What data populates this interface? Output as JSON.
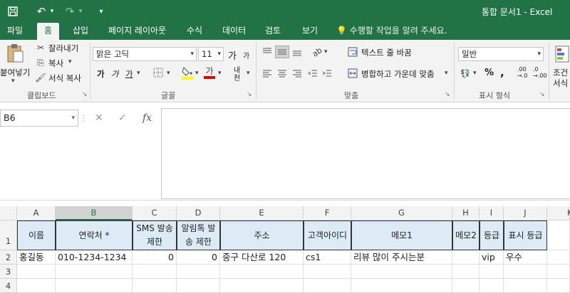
{
  "titlebar": {
    "title": "통합 문서1 - Excel",
    "quick_access": [
      "save-icon",
      "undo-icon",
      "redo-icon",
      "customize-icon"
    ]
  },
  "tabs": [
    "파일",
    "홈",
    "삽입",
    "페이지 레이아웃",
    "수식",
    "데이터",
    "검토",
    "보기"
  ],
  "active_tab": "홈",
  "tell_me": "수행할 작업을 알려 주세요.",
  "ribbon": {
    "clipboard": {
      "paste": "붙여넣기",
      "cut": "잘라내기",
      "copy": "복사",
      "format_painter": "서식 복사",
      "label": "클립보드"
    },
    "font": {
      "font_name": "맑은 고딕",
      "font_size": "11",
      "grow": "가",
      "shrink": "가",
      "bold": "가",
      "italic": "가",
      "underline": "가",
      "color_letter": "가",
      "phonetic": "내천",
      "label": "글꼴"
    },
    "alignment": {
      "wrap_text": "텍스트 줄 바꿈",
      "merge_center": "병합하고 가운데 맞춤",
      "label": "맞춤"
    },
    "number": {
      "format": "일반",
      "percent": "%",
      "comma": ",",
      "increase_decimal": ".00 →.0",
      "decrease_decimal": ".0 →.00",
      "label": "표시 형식"
    },
    "styles": {
      "conditional_line1": "조건",
      "conditional_line2": "서식"
    },
    "colors": {
      "brand": "#217346",
      "header_fill": "#ddebf7",
      "font_color_bar": "#e00000",
      "fill_color_bar": "#ffff00"
    }
  },
  "formula_bar": {
    "name_box": "B6",
    "cancel": "✕",
    "enter": "✓",
    "fx": "fx",
    "formula": ""
  },
  "grid": {
    "columns": [
      "A",
      "B",
      "C",
      "D",
      "E",
      "F",
      "G",
      "H",
      "I",
      "J",
      "K"
    ],
    "selected_column": "B",
    "rows": [
      "1",
      "2",
      "3",
      "4"
    ],
    "header_row": [
      "이름",
      "연락처 *",
      "SMS 발송 제한",
      "알림톡 발송 제한",
      "주소",
      "고객아이디",
      "메모1",
      "메모2",
      "등급",
      "표시 등급"
    ],
    "data_row": [
      "홍길동",
      "010-1234-1234",
      "0",
      "0",
      "중구 다산로 120",
      "cs1",
      "리뷰 많이 주시는분",
      "",
      "vip",
      "우수"
    ]
  }
}
